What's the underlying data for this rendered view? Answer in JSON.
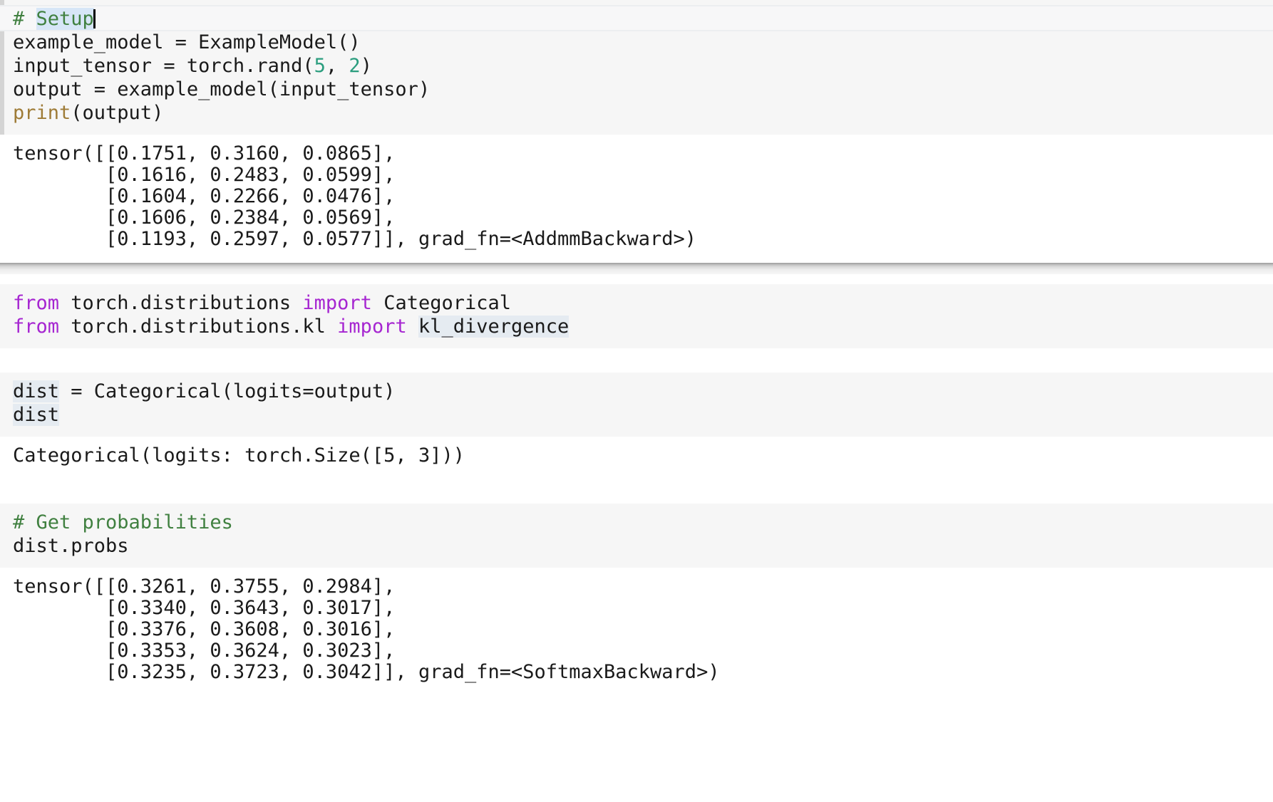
{
  "app": {
    "kind": "jupyter-notebook",
    "colors": {
      "code_background": "#f6f6f6",
      "output_background": "#ffffff",
      "cell_bar": "#d4d4d4",
      "comment": "#408040",
      "keyword": "#a626d1",
      "builtin": "#9e7b36",
      "number": "#2a9d7e",
      "selection": "#d7e6f7",
      "variable_highlight": "#e5ebf1",
      "caret": "#000000"
    }
  },
  "cells": [
    {
      "id": "cell-1",
      "type": "code",
      "focused": true,
      "code_lines": [
        {
          "id": "c1l1",
          "active": true,
          "tokens": [
            {
              "t": "# ",
              "k": "comment"
            },
            {
              "t": "Setup",
              "k": "comment",
              "sel": true
            },
            {
              "caret": true
            }
          ]
        },
        {
          "id": "c1l2",
          "active": false,
          "tokens": [
            {
              "t": "example_model = ExampleModel()",
              "k": "plain"
            }
          ]
        },
        {
          "id": "c1l3",
          "active": false,
          "tokens": [
            {
              "t": "input_tensor = torch.rand(",
              "k": "plain"
            },
            {
              "t": "5",
              "k": "num"
            },
            {
              "t": ", ",
              "k": "plain"
            },
            {
              "t": "2",
              "k": "num"
            },
            {
              "t": ")",
              "k": "plain"
            }
          ]
        },
        {
          "id": "c1l4",
          "active": false,
          "tokens": [
            {
              "t": "output = example_model(input_tensor)",
              "k": "plain"
            }
          ]
        },
        {
          "id": "c1l5",
          "active": false,
          "tokens": [
            {
              "t": "print",
              "k": "builtin"
            },
            {
              "t": "(output)",
              "k": "plain"
            }
          ]
        }
      ],
      "output_lines": [
        "tensor([[0.1751, 0.3160, 0.0865],",
        "        [0.1616, 0.2483, 0.0599],",
        "        [0.1604, 0.2266, 0.0476],",
        "        [0.1606, 0.2384, 0.0569],",
        "        [0.1193, 0.2597, 0.0577]], grad_fn=<AddmmBackward>)"
      ]
    },
    {
      "id": "cell-2",
      "type": "code",
      "focused": false,
      "code_lines": [
        {
          "id": "c2l1",
          "active": false,
          "tokens": [
            {
              "t": "from",
              "k": "kw"
            },
            {
              "t": " torch.distributions ",
              "k": "plain"
            },
            {
              "t": "import",
              "k": "kw"
            },
            {
              "t": " Categorical",
              "k": "plain"
            }
          ]
        },
        {
          "id": "c2l2",
          "active": false,
          "tokens": [
            {
              "t": "from",
              "k": "kw"
            },
            {
              "t": " torch.distributions.kl ",
              "k": "plain"
            },
            {
              "t": "import",
              "k": "kw"
            },
            {
              "t": " ",
              "k": "plain"
            },
            {
              "t": "kl_divergence",
              "k": "plain",
              "vhl": true
            }
          ]
        }
      ],
      "output_lines": []
    },
    {
      "id": "cell-3",
      "type": "code",
      "focused": false,
      "code_lines": [
        {
          "id": "c3l1",
          "active": false,
          "tokens": [
            {
              "t": "dist",
              "k": "plain",
              "vhl": true
            },
            {
              "t": " = Categorical(logits=output)",
              "k": "plain"
            }
          ]
        },
        {
          "id": "c3l2",
          "active": false,
          "tokens": [
            {
              "t": "dist",
              "k": "plain",
              "vhl": true
            }
          ]
        }
      ],
      "output_lines": [
        "Categorical(logits: torch.Size([5, 3]))"
      ]
    },
    {
      "id": "cell-4",
      "type": "code",
      "focused": false,
      "code_lines": [
        {
          "id": "c4l1",
          "active": false,
          "tokens": [
            {
              "t": "# Get probabilities",
              "k": "comment"
            }
          ]
        },
        {
          "id": "c4l2",
          "active": false,
          "tokens": [
            {
              "t": "dist.probs",
              "k": "plain"
            }
          ]
        }
      ],
      "output_lines": [
        "tensor([[0.3261, 0.3755, 0.2984],",
        "        [0.3340, 0.3643, 0.3017],",
        "        [0.3376, 0.3608, 0.3016],",
        "        [0.3353, 0.3624, 0.3023],",
        "        [0.3235, 0.3723, 0.3042]], grad_fn=<SoftmaxBackward>)"
      ]
    }
  ]
}
